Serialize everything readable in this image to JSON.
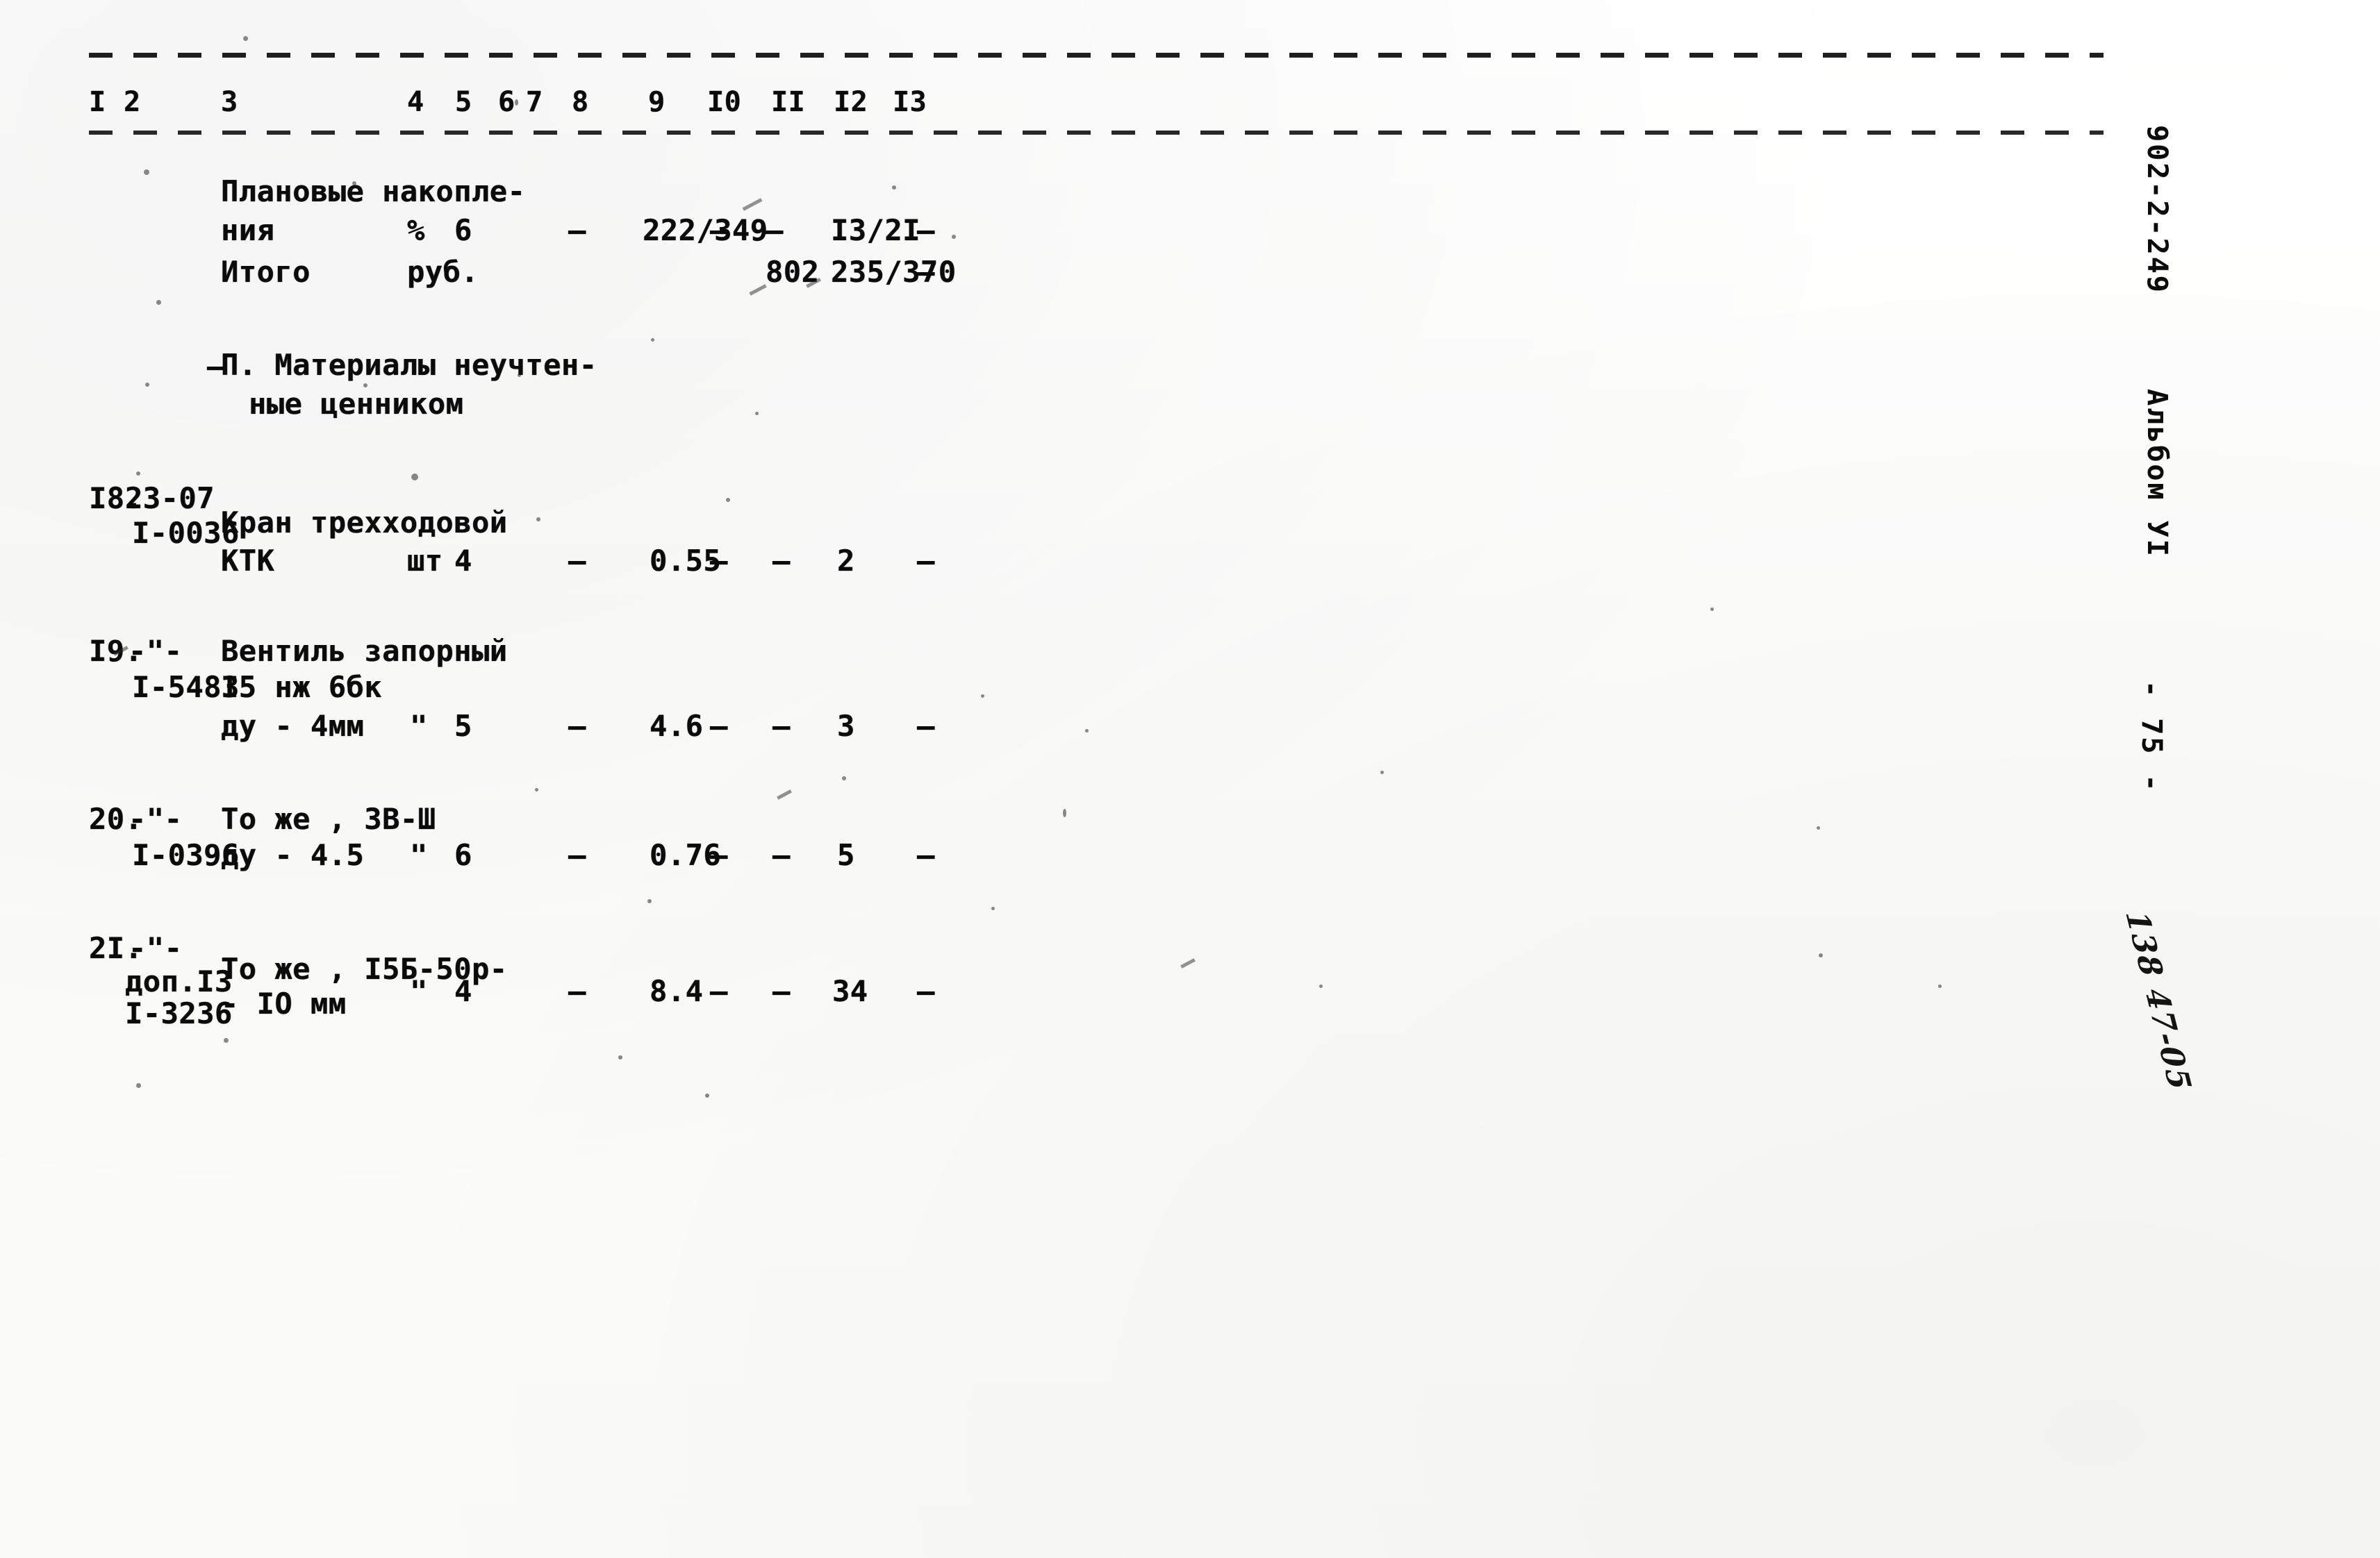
{
  "document": {
    "kind": "scanned-typewritten-estimate-table",
    "language": "ru"
  },
  "table": {
    "column_numbers": [
      "I",
      "2",
      "3",
      "4",
      "5",
      "6",
      "7",
      "8",
      "9",
      "I0",
      "II",
      "I2",
      "I3"
    ],
    "rows": [
      {
        "no": "",
        "code": "",
        "name_lines": [
          "Плановые накопле-",
          "ния"
        ],
        "unit": "%",
        "c5": "6",
        "c6": "",
        "c7": "",
        "c8": "–",
        "c9": "222/349",
        "c10": "–",
        "c11": "–",
        "c12": "I3/2I",
        "c13": "–"
      },
      {
        "no": "",
        "code": "",
        "name_lines": [
          "Итого"
        ],
        "unit": "руб.",
        "c5": "",
        "c6": "",
        "c7": "",
        "c8": "",
        "c9": "",
        "c10": "",
        "c11": "802",
        "c12": "235/370",
        "c13": "–"
      }
    ],
    "section_heading": [
      "П. Материалы неучтен-",
      "ные ценником"
    ],
    "material_rows": [
      {
        "no": "I8.",
        "code_lines": [
          "23-07",
          "I-0036"
        ],
        "name_lines": [
          "Кран трехходовой",
          "КТК"
        ],
        "unit": "шт",
        "c5": "4",
        "c8": "–",
        "c9": "0.55",
        "c10": "–",
        "c11": "–",
        "c12": "2",
        "c13": "–"
      },
      {
        "no": "I9.",
        "code_lines": [
          "-\"-",
          "I-5483"
        ],
        "name_lines": [
          "Вентиль запорный",
          "I5 нж 6бк",
          "ду - 4мм"
        ],
        "unit": "\"",
        "c5": "5",
        "c8": "–",
        "c9": "4.6",
        "c10": "–",
        "c11": "–",
        "c12": "3",
        "c13": "–"
      },
      {
        "no": "20.",
        "code_lines": [
          "-\"-",
          "I-0396"
        ],
        "name_lines": [
          "То же , 3В-Ш",
          "ду - 4.5"
        ],
        "unit": "\"",
        "c5": "6",
        "c8": "–",
        "c9": "0.76",
        "c10": "–",
        "c11": "–",
        "c12": "5",
        "c13": "–"
      },
      {
        "no": "2I.",
        "code_lines": [
          "-\"-",
          "доп.I3",
          "I-3236"
        ],
        "name_lines": [
          "То же , I5Б-50р-",
          "- IO мм"
        ],
        "unit": "\"",
        "c5": "4",
        "c8": "–",
        "c9": "8.4",
        "c10": "–",
        "c11": "–",
        "c12": "34",
        "c13": "–"
      }
    ]
  },
  "margin": {
    "doc_code": "902-2-249",
    "album": "Альбом УI",
    "page": "- 75 -",
    "handwritten": "138 47-05"
  }
}
